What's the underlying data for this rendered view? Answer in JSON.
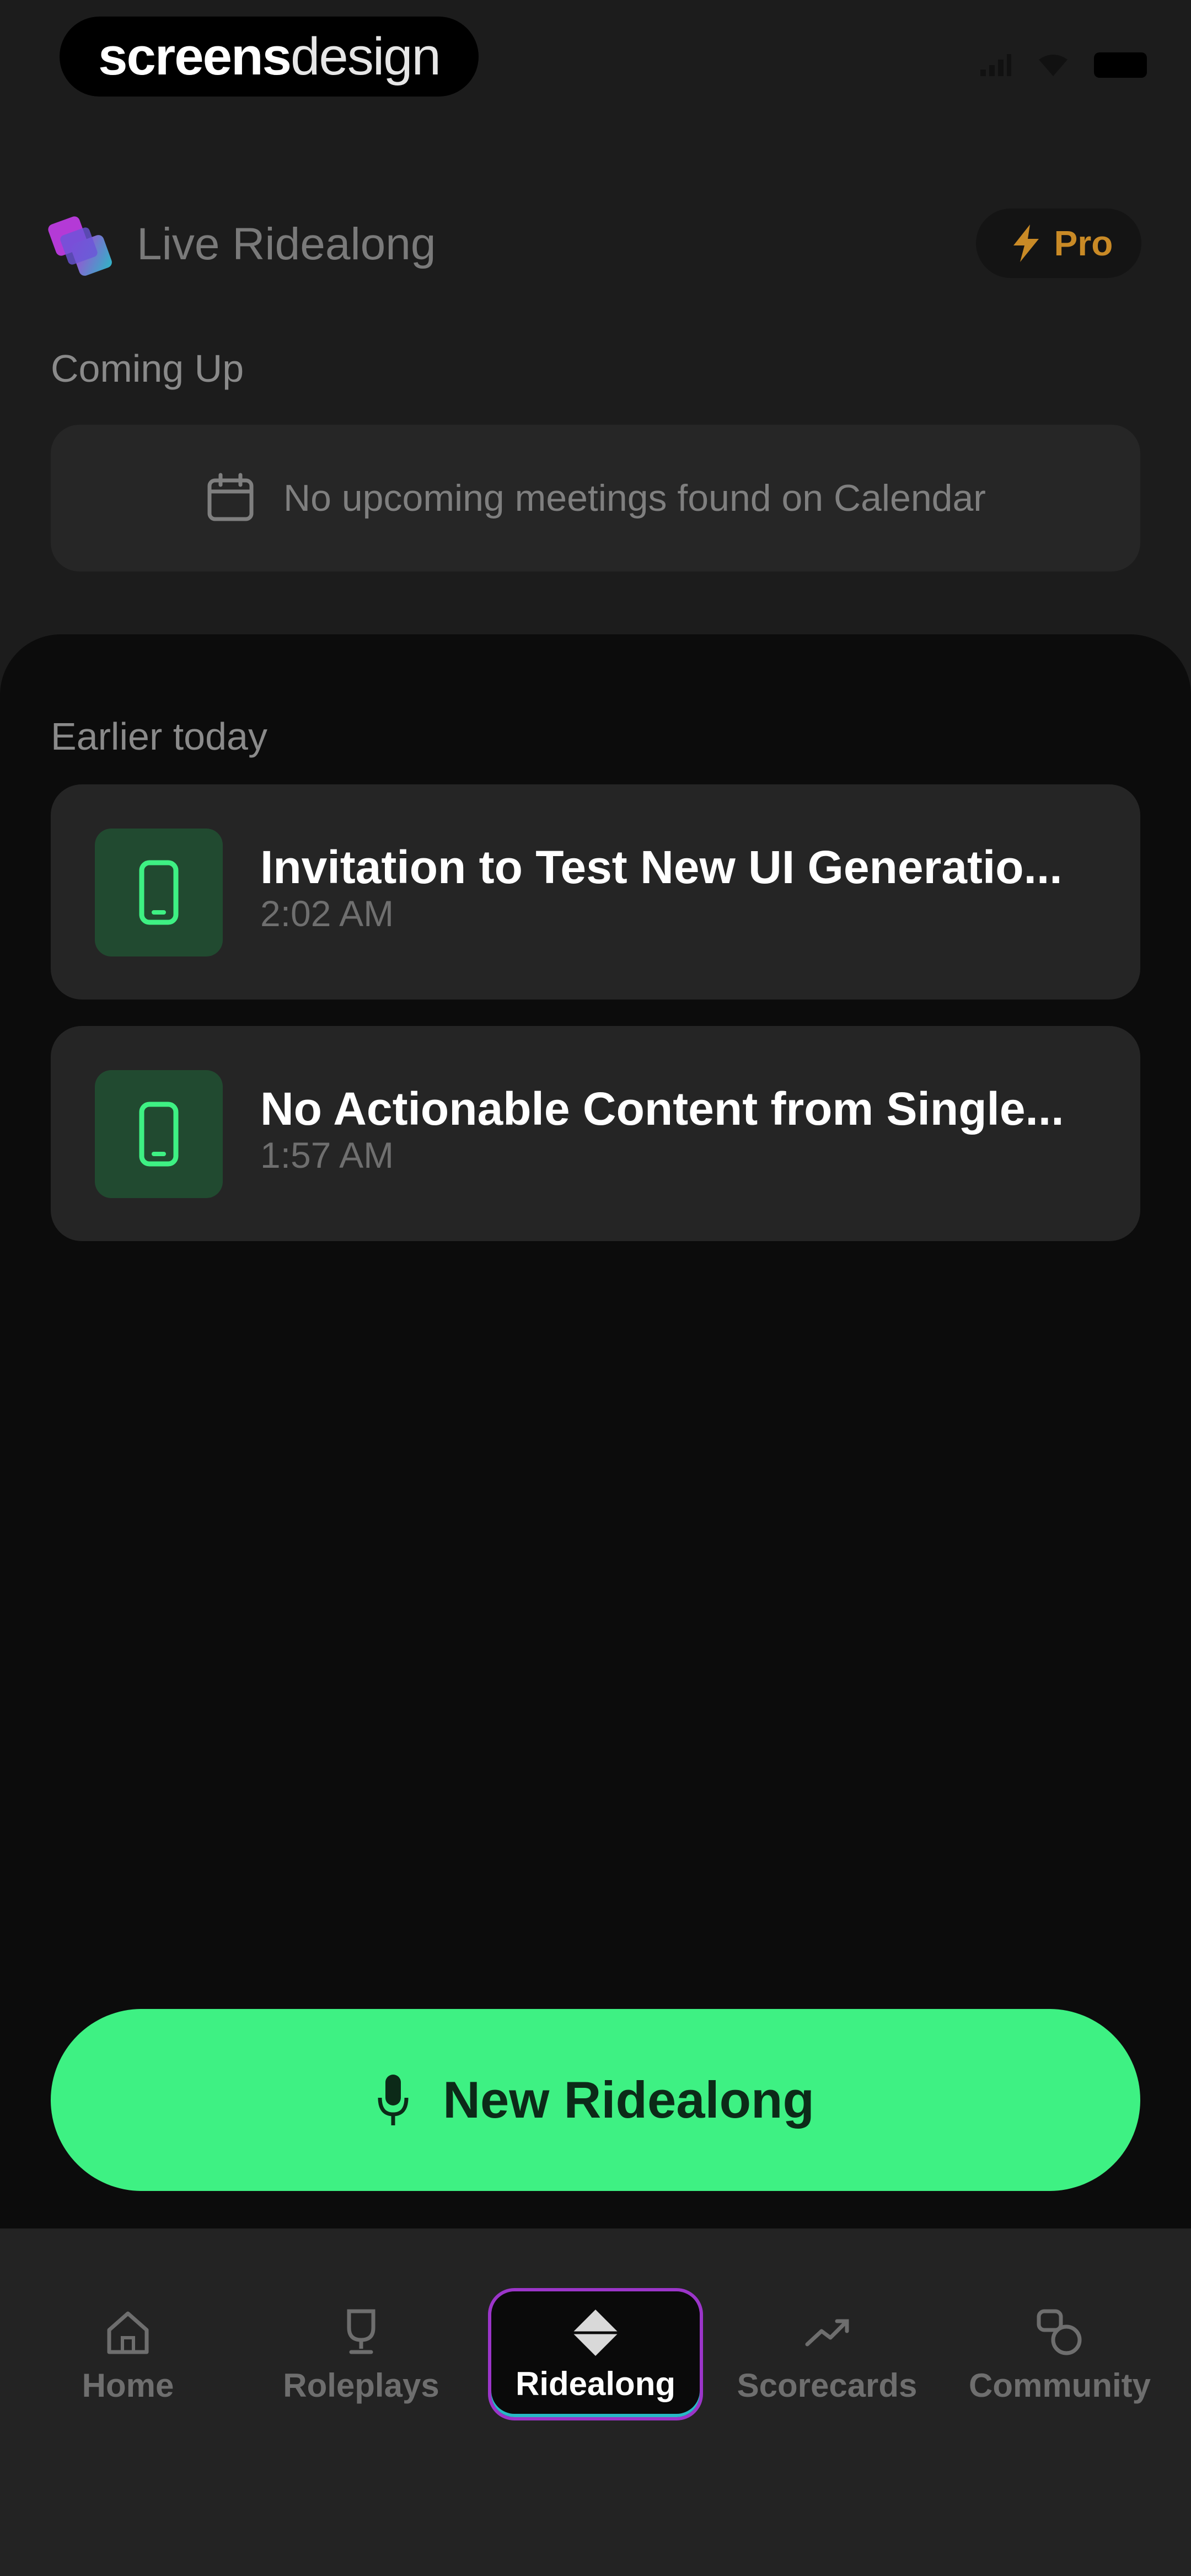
{
  "status_bar": {
    "brand_strong": "screens",
    "brand_light": "design"
  },
  "header": {
    "title": "Live Ridealong",
    "pro_badge": "Pro"
  },
  "coming_up": {
    "label": "Coming Up",
    "empty_message": "No upcoming meetings found on Calendar"
  },
  "earlier": {
    "label": "Earlier today",
    "items": [
      {
        "title": "Invitation to Test New UI Generatio...",
        "time": "2:02 AM",
        "icon": "phone-icon"
      },
      {
        "title": "No Actionable Content from Single...",
        "time": "1:57 AM",
        "icon": "phone-icon"
      }
    ]
  },
  "cta": {
    "label": "New Ridealong",
    "icon": "microphone-icon"
  },
  "nav": {
    "items": [
      {
        "label": "Home",
        "icon": "home-icon"
      },
      {
        "label": "Roleplays",
        "icon": "trophy-icon"
      },
      {
        "label": "Ridealong",
        "icon": "diamond-icon",
        "active": true
      },
      {
        "label": "Scorecards",
        "icon": "trend-icon"
      },
      {
        "label": "Community",
        "icon": "community-icon"
      }
    ]
  },
  "colors": {
    "accent_green": "#3ef183",
    "pro_gold": "#c98a26",
    "active_border_purple": "#9b35c9",
    "active_border_teal": "#27b9c5"
  }
}
